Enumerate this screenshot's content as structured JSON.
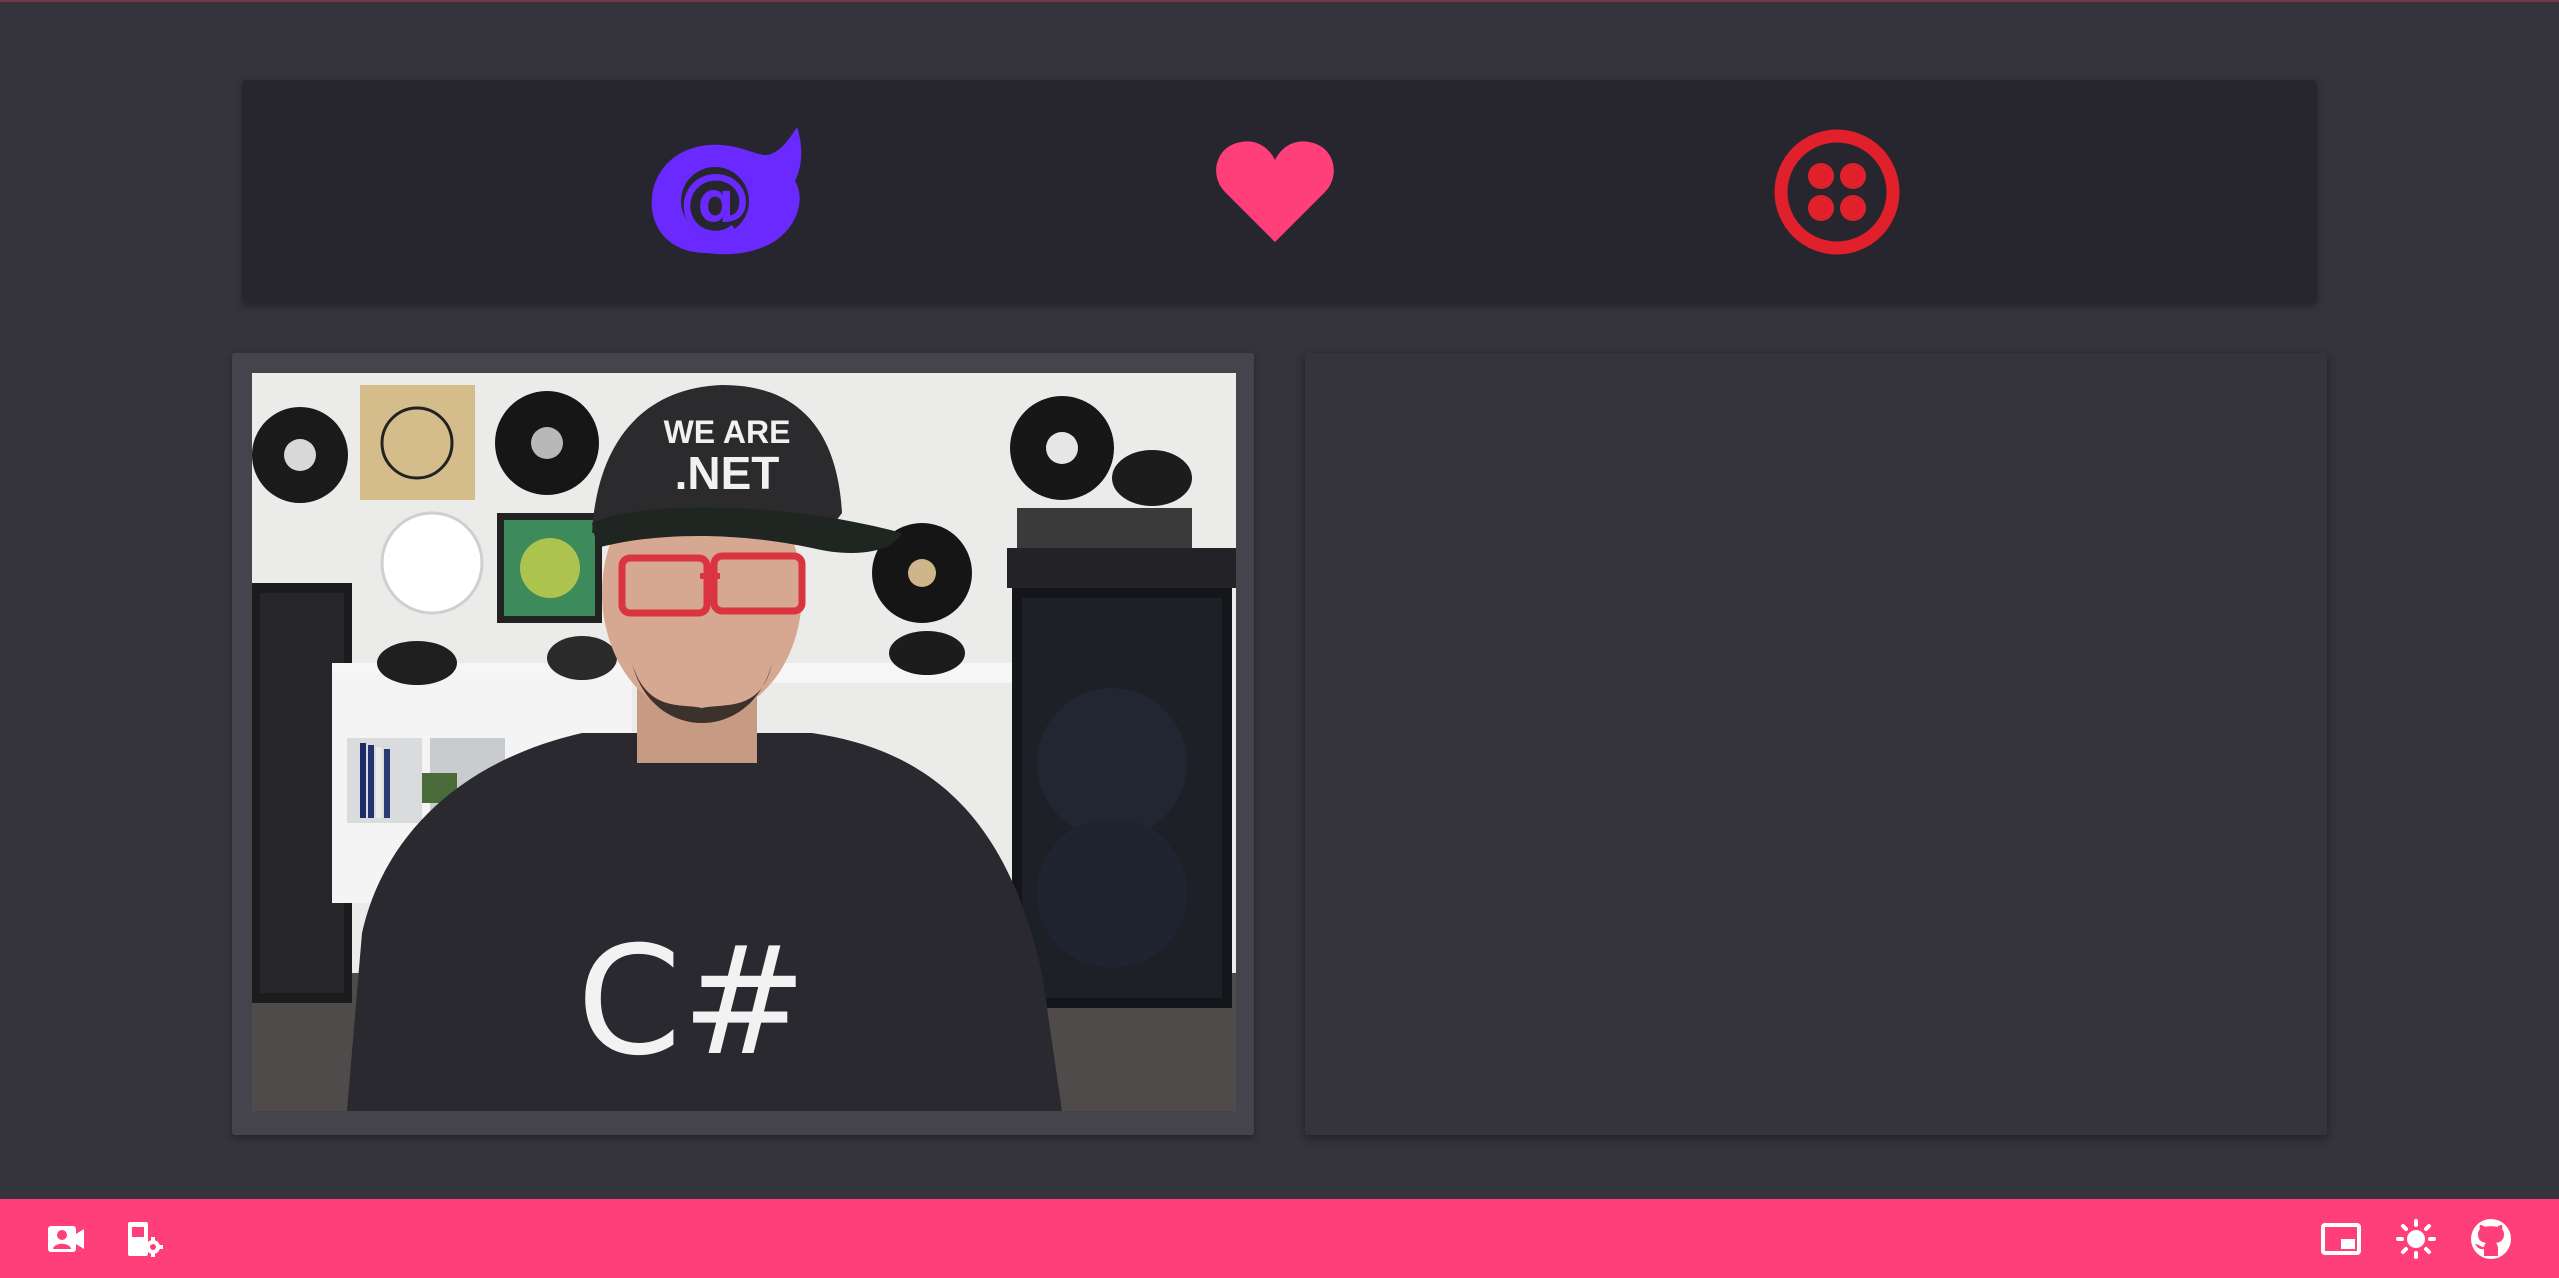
{
  "header": {
    "logos": [
      {
        "icon": "blazor-logo-icon",
        "color": "#6a29ff"
      },
      {
        "icon": "heart-icon",
        "color": "#ff3f79"
      },
      {
        "icon": "twilio-logo-icon",
        "color": "#e0202b"
      }
    ]
  },
  "video": {
    "cap_line1": "WE ARE",
    "cap_line2": ".NET",
    "shirt_text": "C#"
  },
  "footer": {
    "left_buttons": [
      {
        "icon": "camera-user-icon"
      },
      {
        "icon": "device-settings-icon"
      }
    ],
    "right_buttons": [
      {
        "icon": "picture-in-picture-icon"
      },
      {
        "icon": "brightness-icon"
      },
      {
        "icon": "github-icon"
      }
    ],
    "accent": "#ff3f79"
  }
}
